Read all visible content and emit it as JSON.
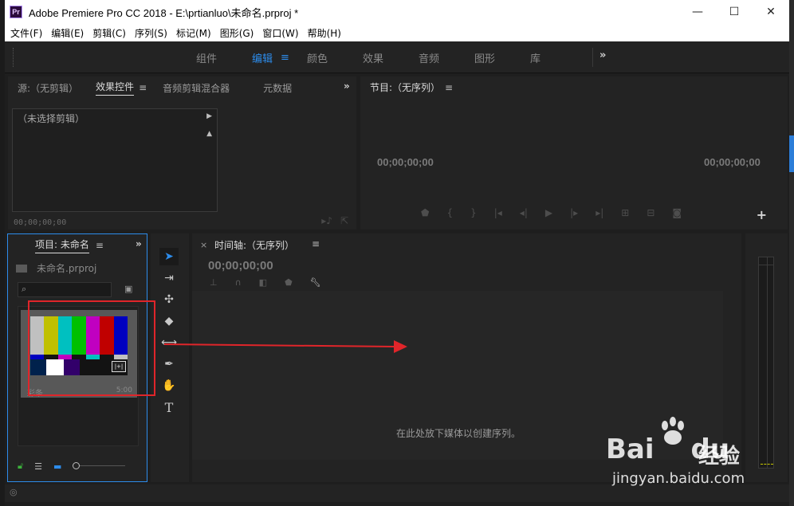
{
  "window": {
    "title": "Adobe Premiere Pro CC 2018 - E:\\prtianluo\\未命名.prproj *",
    "app_icon_text": "Pr",
    "minimize": "—",
    "maximize": "☐",
    "close": "✕"
  },
  "menu": [
    "文件(F)",
    "编辑(E)",
    "剪辑(C)",
    "序列(S)",
    "标记(M)",
    "图形(G)",
    "窗口(W)",
    "帮助(H)"
  ],
  "workspace": {
    "tabs": [
      "组件",
      "编辑",
      "颜色",
      "效果",
      "音频",
      "图形",
      "库"
    ],
    "active_index": 1,
    "menu_icon": "≡",
    "more": "»"
  },
  "source_panel": {
    "tabs": [
      "源:（无剪辑）",
      "效果控件",
      "音频剪辑混合器",
      "元数据"
    ],
    "active_index": 1,
    "menu_icon": "≡",
    "more": "»",
    "no_clip_label": "（未选择剪辑）",
    "timecode": "00;00;00;00"
  },
  "program_panel": {
    "title": "节目:（无序列）",
    "menu_icon": "≡",
    "timecode_left": "00;00;00;00",
    "timecode_right": "00;00;00;00",
    "controls": [
      "marker-icon",
      "mark-in-icon",
      "mark-out-icon",
      "go-to-in-icon",
      "step-back-icon",
      "play-icon",
      "step-forward-icon",
      "go-to-out-icon",
      "lift-icon",
      "extract-icon",
      "export-frame-icon"
    ],
    "add_button": "+"
  },
  "project_panel": {
    "title": "项目: 未命名",
    "menu_icon": "≡",
    "more": "»",
    "file_name": "未命名.prproj",
    "search_placeholder": "",
    "clip_label": "彩条",
    "clip_duration": "5:00",
    "badge": "|+|"
  },
  "timeline_panel": {
    "close": "×",
    "title": "时间轴:（无序列）",
    "menu_icon": "≡",
    "timecode": "00;00;00;00",
    "hint": "在此处放下媒体以创建序列。"
  },
  "colors": {
    "accent_blue": "#2d8ceb",
    "annotation_red": "#e0252a",
    "panel_bg": "#232323",
    "lock_green": "#3cb33c"
  },
  "watermark": {
    "brand": "Bai",
    "brand2": "du",
    "jingyan": "经验",
    "url": "jingyan.baidu.com"
  }
}
